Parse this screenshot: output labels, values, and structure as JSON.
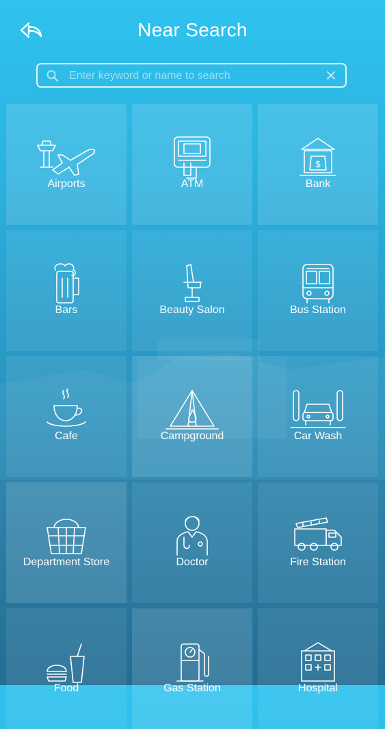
{
  "header": {
    "title": "Near Search",
    "back_icon": "back-arrow-icon"
  },
  "search": {
    "placeholder": "Enter keyword or name to search",
    "value": "",
    "search_icon": "search-icon",
    "clear_icon": "clear-icon"
  },
  "categories": [
    {
      "label": "Airports",
      "icon": "airport-icon"
    },
    {
      "label": "ATM",
      "icon": "atm-icon"
    },
    {
      "label": "Bank",
      "icon": "bank-icon"
    },
    {
      "label": "Bars",
      "icon": "beer-mug-icon"
    },
    {
      "label": "Beauty Salon",
      "icon": "salon-chair-icon"
    },
    {
      "label": "Bus Station",
      "icon": "bus-icon"
    },
    {
      "label": "Cafe",
      "icon": "coffee-cup-icon"
    },
    {
      "label": "Campground",
      "icon": "tent-icon"
    },
    {
      "label": "Car Wash",
      "icon": "car-wash-icon"
    },
    {
      "label": "Department Store",
      "icon": "shopping-basket-icon"
    },
    {
      "label": "Doctor",
      "icon": "doctor-icon"
    },
    {
      "label": "Fire Station",
      "icon": "fire-truck-icon"
    },
    {
      "label": "Food",
      "icon": "fast-food-icon"
    },
    {
      "label": "Gas Station",
      "icon": "gas-pump-icon"
    },
    {
      "label": "Hospital",
      "icon": "hospital-icon"
    }
  ],
  "colors": {
    "bg_top": "#2fc3ef",
    "bg_bottom": "#1d6d95",
    "text": "#ffffff"
  }
}
